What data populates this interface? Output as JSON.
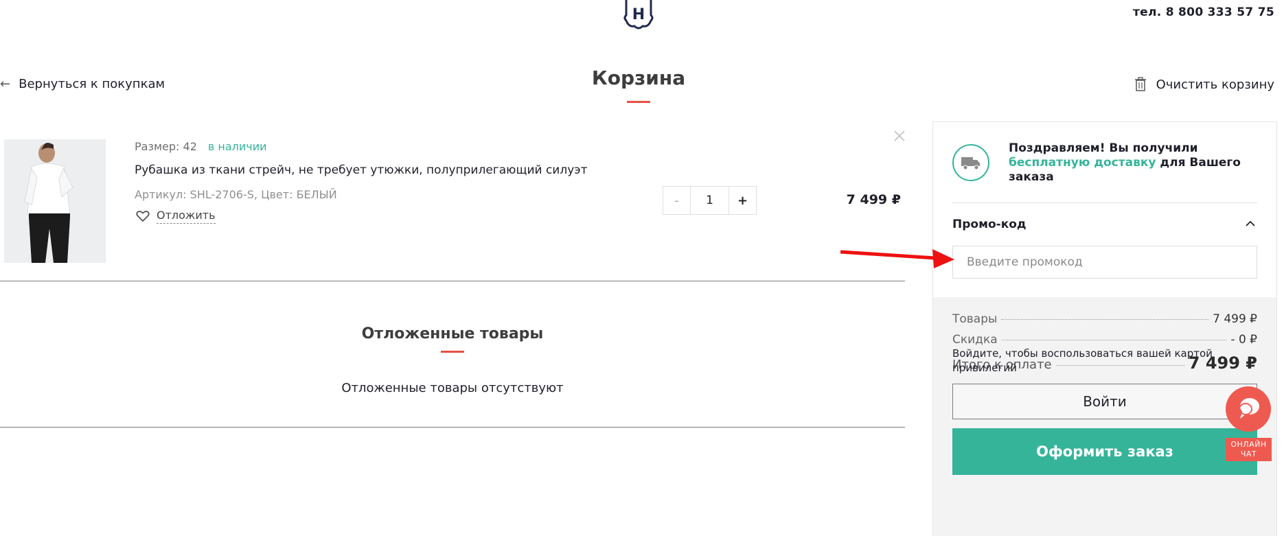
{
  "header": {
    "logo_letter": "Н",
    "phone": "тел. 8 800 333 57 75",
    "back_label": "Вернуться к покупкам",
    "title": "Корзина",
    "clear_label": "Очистить корзину"
  },
  "cart_item": {
    "size": "Размер: 42",
    "availability": "в наличии",
    "name": "Рубашка из ткани стрейч, не требует утюжки, полуприлегающий силуэт",
    "sku": "Артикул: SHL-2706-S, Цвет: БЕЛЫЙ",
    "save_label": "Отложить",
    "quantity": "1",
    "qty_minus": "-",
    "qty_plus": "+",
    "price": "7 499 ₽"
  },
  "deferred": {
    "title": "Отложенные товары",
    "empty_text": "Отложенные товары отсутствуют"
  },
  "summary": {
    "congrats_prefix": "Поздравляем! Вы получили ",
    "congrats_highlight": "бесплатную доставку",
    "congrats_suffix": " для Вашего заказа",
    "promo_label": "Промо-код",
    "promo_placeholder": "Введите промокод",
    "goods_label": "Товары",
    "goods_value": "7 499 ₽",
    "discount_label": "Скидка",
    "discount_value": "- 0 ₽",
    "total_label": "Итого к оплате",
    "total_value": "7 499 ₽",
    "login_hint": "Войдите, чтобы воспользоваться вашей картой привилегий",
    "login_button": "Войти",
    "order_button": "Оформить заказ"
  },
  "chat": {
    "label_line1": "ОНЛАЙН",
    "label_line2": "ЧАТ"
  },
  "colors": {
    "accent_green": "#35b49a",
    "accent_red": "#e94e45",
    "chat_red": "#ef5a50"
  }
}
